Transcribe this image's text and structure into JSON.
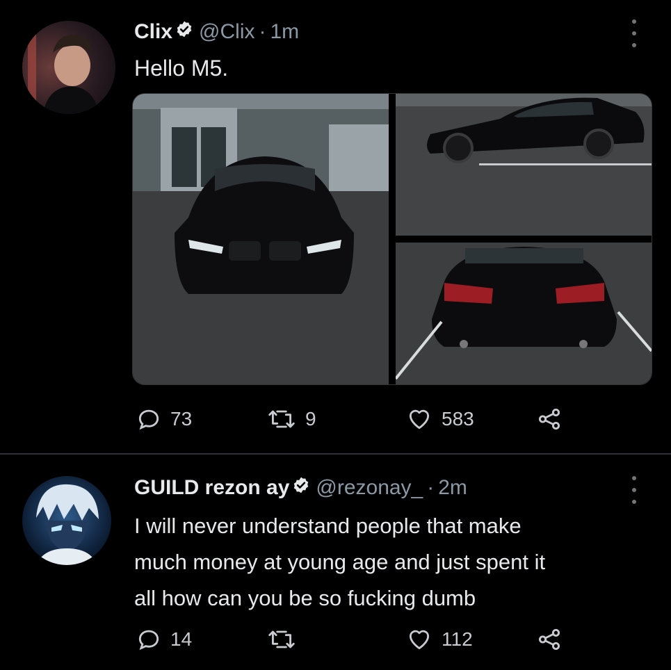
{
  "tweets": [
    {
      "author": {
        "name": "Clix",
        "handle": "@Clix",
        "time": "1m",
        "verified": true
      },
      "text": "Hello M5.",
      "media": [
        "car-front-photo",
        "car-side-photo",
        "car-rear-photo"
      ],
      "stats": {
        "replies": "73",
        "retweets": "9",
        "likes": "583"
      }
    },
    {
      "author": {
        "name": "GUILD rezon ay",
        "handle": "@rezonay_",
        "time": "2m",
        "verified": true
      },
      "text_lines": [
        "I will never understand people that make",
        "much money at young age and just spent it",
        "all how can you be so fucking dumb"
      ],
      "stats": {
        "replies": "14",
        "retweets": "",
        "likes": "112"
      }
    }
  ],
  "icons": {
    "reply": "reply-icon",
    "retweet": "retweet-icon",
    "like": "heart-icon",
    "share": "share-icon",
    "more": "more-icon",
    "verified": "verified-badge-icon"
  },
  "colors": {
    "background": "#000000",
    "text": "#e7e9ea",
    "muted": "#8b98a5",
    "divider": "#2f3336"
  }
}
